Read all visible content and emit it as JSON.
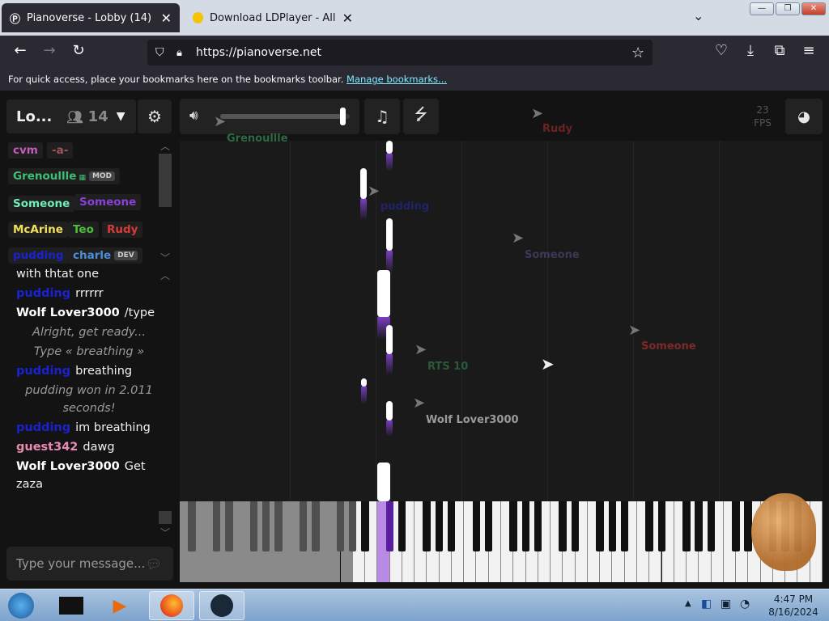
{
  "browser": {
    "tabs": [
      {
        "title": "Pianoverse - Lobby (14)",
        "close": "✕"
      },
      {
        "title": "Download LDPlayer - All Version",
        "close": "✕"
      }
    ],
    "url": "https://pianoverse.net",
    "bookmarks_text": "For quick access, place your bookmarks here on the bookmarks toolbar.",
    "bookmarks_link": "Manage bookmarks..."
  },
  "room": {
    "name": "Lo...",
    "count": "14"
  },
  "users": [
    {
      "name": "cvm",
      "color": "#c45cba"
    },
    {
      "name": "-a-",
      "color": "#a0565b"
    },
    {
      "name": "Grenoullle",
      "color": "#3fbf74",
      "badge": "MOD"
    },
    {
      "name": "Someone",
      "color": "#6ef0b8"
    },
    {
      "name": "Someone",
      "color": "#8a3fd6"
    },
    {
      "name": "McArine",
      "color": "#f1e05a"
    },
    {
      "name": "Teo",
      "color": "#4fbf3a"
    },
    {
      "name": "Rudy",
      "color": "#d83a3a"
    },
    {
      "name": "pudding",
      "color": "#1a22d0"
    },
    {
      "name": "charle",
      "color": "#4c8fd8",
      "badge": "DEV"
    }
  ],
  "chat": [
    {
      "name": "",
      "text": "with thtat one",
      "color": "#ffffff"
    },
    {
      "name": "pudding",
      "text": "rrrrrr",
      "color": "#1a22d0"
    },
    {
      "name": "Wolf Lover3000",
      "text": "/type",
      "color": "#ffffff"
    },
    {
      "system": "Alright, get ready..."
    },
    {
      "system": "Type « breathing »"
    },
    {
      "name": "pudding",
      "text": "breathing",
      "color": "#1a22d0"
    },
    {
      "system": "pudding won in 2.011 seconds!"
    },
    {
      "name": "pudding",
      "text": "im breathing",
      "color": "#1a22d0"
    },
    {
      "name": "guest342",
      "text": "dawg",
      "color": "#e88bb0"
    },
    {
      "name": "Wolf Lover3000",
      "text": "Get zaza",
      "color": "#ffffff"
    }
  ],
  "chat_placeholder": "Type your message...",
  "fps": {
    "value": "23",
    "label": "FPS"
  },
  "volume_level": 0.95,
  "cursors": [
    {
      "name": "Grenoullle",
      "color": "#2d6a44"
    },
    {
      "name": "Rudy",
      "color": "#6b2222"
    },
    {
      "name": "pudding",
      "color": "#22226b"
    },
    {
      "name": "Someone",
      "color": "#3a3a56"
    },
    {
      "name": "Someone",
      "color": "#7a2a2a"
    },
    {
      "name": "RTS 10",
      "color": "#2a5a3a"
    },
    {
      "name": "Wolf Lover3000",
      "color": "#9a9a9a"
    }
  ],
  "taskbar": {
    "time": "4:47 PM",
    "date": "8/16/2024"
  }
}
